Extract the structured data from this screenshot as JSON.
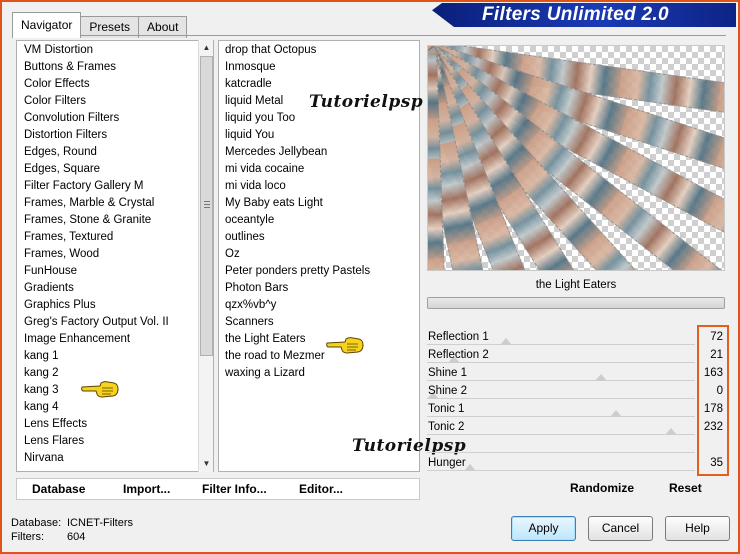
{
  "tabs": [
    "Navigator",
    "Presets",
    "About"
  ],
  "banner_title": "Filters Unlimited 2.0",
  "categories": [
    "VM Distortion",
    "Buttons & Frames",
    "Color Effects",
    "Color Filters",
    "Convolution Filters",
    "Distortion Filters",
    "Edges, Round",
    "Edges, Square",
    "Filter Factory Gallery M",
    "Frames, Marble & Crystal",
    "Frames, Stone & Granite",
    "Frames, Textured",
    "Frames, Wood",
    "FunHouse",
    "Gradients",
    "Graphics Plus",
    "Greg's Factory Output Vol. II",
    "Image Enhancement",
    "kang 1",
    "kang 2",
    "kang 3",
    "kang 4",
    "Lens Effects",
    "Lens Flares",
    "Nirvana"
  ],
  "filters": [
    "drop that Octopus",
    "Inmosque",
    "katcradle",
    "liquid Metal",
    "liquid you Too",
    "liquid You",
    "Mercedes Jellybean",
    "mi vida cocaine",
    "mi vida loco",
    "My Baby eats Light",
    "oceantyle",
    "outlines",
    "Oz",
    "Peter ponders pretty Pastels",
    "Photon Bars",
    "qzx%vb^y",
    "Scanners",
    "the Light Eaters",
    "the road to Mezmer",
    "waxing a Lizard"
  ],
  "watermark": "Tutorielpsp",
  "selected_filter": "the Light Eaters",
  "params": [
    {
      "label": "Reflection 1",
      "value": "72",
      "level": 0.28
    },
    {
      "label": "Reflection 2",
      "value": "21",
      "level": 0.08
    },
    {
      "label": "Shine 1",
      "value": "163",
      "level": 0.64
    },
    {
      "label": "Shine 2",
      "value": "0",
      "level": 0.0
    },
    {
      "label": "Tonic 1",
      "value": "178",
      "level": 0.7
    },
    {
      "label": "Tonic 2",
      "value": "232",
      "level": 0.91
    },
    {
      "label": "",
      "value": "",
      "level": null
    },
    {
      "label": "Hunger",
      "value": "35",
      "level": 0.14
    }
  ],
  "commands": {
    "database": "Database",
    "import": "Import...",
    "filter_info": "Filter Info...",
    "editor": "Editor...",
    "randomize": "Randomize",
    "reset": "Reset"
  },
  "info": {
    "database_label": "Database:",
    "database_value": "ICNET-Filters",
    "filters_label": "Filters:",
    "filters_value": "604"
  },
  "buttons": {
    "apply": "Apply",
    "cancel": "Cancel",
    "help": "Help"
  },
  "colors": {
    "frame": "#e0541c",
    "banner": "#1b3bb5",
    "highlight": "#e0611e",
    "hand": "#f5d21c"
  }
}
